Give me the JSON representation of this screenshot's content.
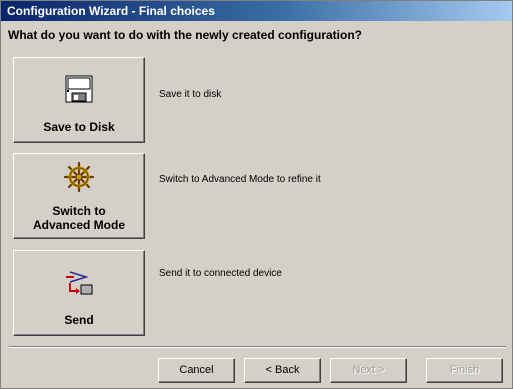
{
  "window": {
    "title": "Configuration Wizard - Final choices"
  },
  "question": "What do you want to do with the newly created configuration?",
  "options": [
    {
      "label_line1": "Save to Disk",
      "label_line2": "",
      "description": "Save it to disk",
      "icon": "floppy-disk-icon"
    },
    {
      "label_line1": "Switch to",
      "label_line2": "Advanced Mode",
      "description": "Switch to Advanced Mode to refine it",
      "icon": "ship-wheel-icon"
    },
    {
      "label_line1": "Send",
      "label_line2": "",
      "description": "Send it to connected device",
      "icon": "send-to-device-icon"
    }
  ],
  "nav": {
    "cancel": "Cancel",
    "back": "< Back",
    "next": "Next >",
    "finish": "Finish",
    "next_enabled": false,
    "finish_enabled": false
  },
  "colors": {
    "titlebar_start": "#0a246a",
    "face": "#d4d0c8",
    "disabled_text": "#a0a0a0"
  }
}
